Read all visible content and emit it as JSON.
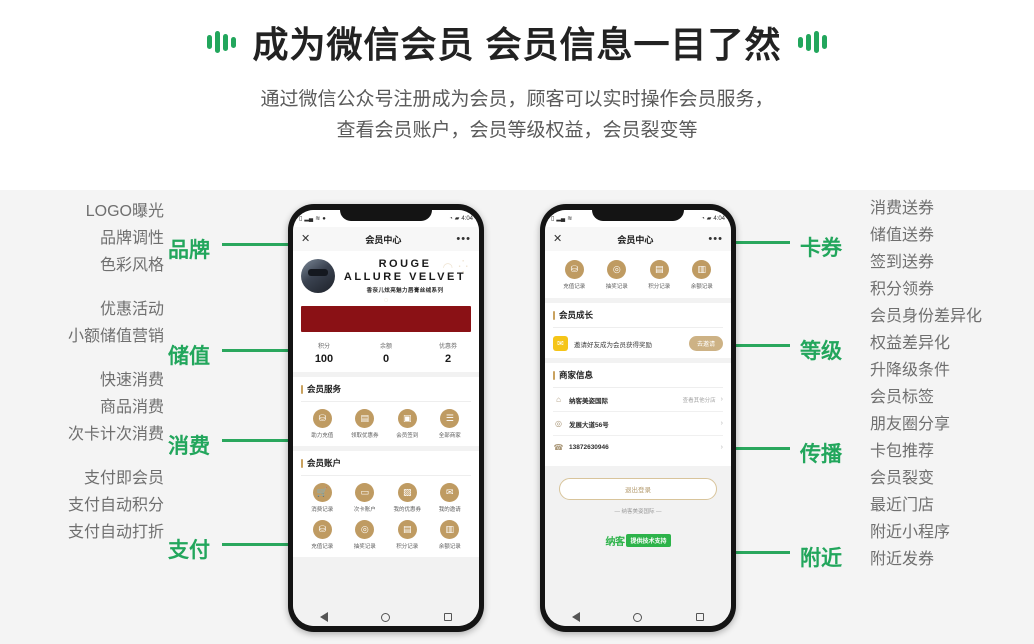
{
  "header": {
    "title": "成为微信会员 会员信息一目了然",
    "subtitle_line1": "通过微信公众号注册成为会员，顾客可以实时操作会员服务，",
    "subtitle_line2": "查看会员账户，会员等级权益，会员裂变等",
    "decoration_icon_left": "sound-bars-icon",
    "decoration_icon_right": "sound-bars-icon"
  },
  "accent_colors": {
    "green": "#22a65c",
    "gold": "#bf9b62",
    "banner_red": "#8a1115",
    "body_bg": "#f4f4f4"
  },
  "left_groups": [
    {
      "tag": "品牌",
      "items": [
        "LOGO曝光",
        "品牌调性",
        "色彩风格"
      ]
    },
    {
      "tag": "储值",
      "items": [
        "优惠活动",
        "小额储值营销"
      ]
    },
    {
      "tag": "消费",
      "items": [
        "快速消费",
        "商品消费",
        "次卡计次消费"
      ]
    },
    {
      "tag": "支付",
      "items": [
        "支付即会员",
        "支付自动积分",
        "支付自动打折"
      ]
    }
  ],
  "right_groups": [
    {
      "tag": "卡券",
      "items": [
        "消费送券",
        "储值送券",
        "签到送券",
        "积分领券"
      ]
    },
    {
      "tag": "等级",
      "items": [
        "会员身份差异化",
        "权益差异化",
        "升降级条件",
        "会员标签"
      ]
    },
    {
      "tag": "传播",
      "items": [
        "朋友圈分享",
        "卡包推荐",
        "会员裂变"
      ]
    },
    {
      "tag": "附近",
      "items": [
        "最近门店",
        "附近小程序",
        "附近发券"
      ]
    }
  ],
  "phone1": {
    "statusbar": {
      "left_icons": "signal-wifi-icons",
      "right_icons": "battery-time-icons"
    },
    "navbar": {
      "close_icon": "close-icon",
      "title": "会员中心",
      "menu_icon": "more-dots-icon"
    },
    "card": {
      "avatar": "user-avatar",
      "brand_line1": "ROUGE",
      "brand_line2": "ALLURE VELVET",
      "brand_line3": "香奈儿炫亮魅力唇膏丝绒系列",
      "deco_icon": "brand-deco-icon",
      "qr_hint_icon": "question-icon"
    },
    "stats": [
      {
        "label": "积分",
        "value": "100"
      },
      {
        "label": "余额",
        "value": "0"
      },
      {
        "label": "优惠券",
        "value": "2"
      }
    ],
    "services": {
      "title": "会员服务",
      "items": [
        {
          "label": "助力充值",
          "icon": "wallet-icon"
        },
        {
          "label": "领取优惠券",
          "icon": "coupon-icon"
        },
        {
          "label": "会员签到",
          "icon": "checkin-icon"
        },
        {
          "label": "全部商家",
          "icon": "shops-icon"
        }
      ]
    },
    "account": {
      "title": "会员账户",
      "items": [
        {
          "label": "消费记录",
          "icon": "cart-icon"
        },
        {
          "label": "次卡账户",
          "icon": "card-icon"
        },
        {
          "label": "我的优惠券",
          "icon": "ticket-icon"
        },
        {
          "label": "我的邀请",
          "icon": "invite-icon"
        },
        {
          "label": "充值记录",
          "icon": "wallet-icon"
        },
        {
          "label": "抽奖记录",
          "icon": "lottery-icon"
        },
        {
          "label": "积分记录",
          "icon": "points-icon"
        },
        {
          "label": "余额记录",
          "icon": "balance-icon"
        }
      ]
    },
    "androidbar": {
      "back": "back-triangle-icon",
      "home": "home-circle-icon",
      "recents": "recents-square-icon"
    }
  },
  "phone2": {
    "statusbar": {
      "left_icons": "signal-wifi-icons",
      "right_icons": "battery-time-icons"
    },
    "navbar": {
      "close_icon": "close-icon",
      "title": "会员中心",
      "menu_icon": "more-dots-icon"
    },
    "top_items": [
      {
        "label": "充值记录",
        "icon": "wallet-icon"
      },
      {
        "label": "抽奖记录",
        "icon": "lottery-icon"
      },
      {
        "label": "积分记录",
        "icon": "points-icon"
      },
      {
        "label": "余额记录",
        "icon": "balance-icon"
      }
    ],
    "growth": {
      "title": "会员成长",
      "icon": "envelope-icon",
      "text": "邀请好友成为会员获得奖励",
      "button": "去邀请"
    },
    "merchant": {
      "title": "商家信息",
      "rows": [
        {
          "icon": "shop-icon",
          "text": "纳客美姿国际",
          "sub": "查看其他分店",
          "arrow": "chevron-right-icon"
        },
        {
          "icon": "location-icon",
          "text": "发展大道56号",
          "sub": "",
          "arrow": "chevron-right-icon"
        },
        {
          "icon": "phone-icon",
          "text": "13872630946",
          "sub": "",
          "arrow": "chevron-right-icon"
        }
      ]
    },
    "logout_button": "退出登录",
    "shop_line": "— 纳客美姿国际 —",
    "footer_logo_text": "纳客",
    "footer_logo_badge": "提供技术支持",
    "androidbar": {
      "back": "back-triangle-icon",
      "home": "home-circle-icon",
      "recents": "recents-square-icon"
    }
  }
}
